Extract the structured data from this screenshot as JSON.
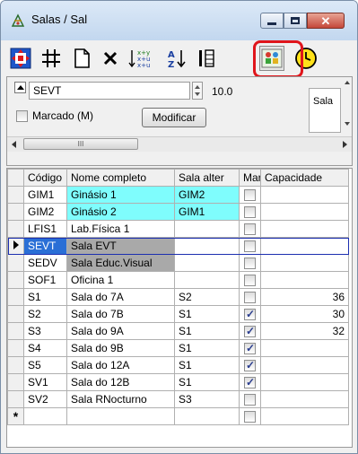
{
  "window": {
    "title": "Salas / Sal",
    "icon": "app-salas-icon"
  },
  "titlebar_buttons": [
    "minimize",
    "maximize",
    "close"
  ],
  "toolbar": {
    "tools": [
      {
        "icon": "navigate-record-icon"
      },
      {
        "icon": "grid-icon"
      },
      {
        "icon": "new-document-icon"
      },
      {
        "icon": "delete-icon"
      },
      {
        "icon": "sort-xy-icon"
      },
      {
        "icon": "sort-az-icon"
      },
      {
        "icon": "columns-icon"
      },
      {
        "icon": "room-people-icon"
      },
      {
        "icon": "clock-icon"
      }
    ],
    "highlighted": "room-people-icon",
    "highlight_color": "#e0151b"
  },
  "edit_panel": {
    "code_value": "SEVT",
    "numeric_value": "10.0",
    "marcado_label": "Marcado (M)",
    "modify_button": "Modificar",
    "sala_label": "Sala",
    "scroll_thumb": "III"
  },
  "grid": {
    "columns": [
      "Código",
      "Nome completo",
      "Sala alter",
      "Marc",
      "Capacidade"
    ],
    "rows": [
      {
        "code": "GIM1",
        "name": "Ginásio 1",
        "alt": "GIM2",
        "marc": false,
        "cap": "",
        "color": "#7ffdfd"
      },
      {
        "code": "GIM2",
        "name": "Ginásio 2",
        "alt": "GIM1",
        "marc": false,
        "cap": "",
        "color": "#7ffdfd"
      },
      {
        "code": "LFIS1",
        "name": "Lab.Física 1",
        "alt": "",
        "marc": false,
        "cap": "",
        "color": ""
      },
      {
        "code": "SEVT",
        "name": "Sala EVT",
        "alt": "",
        "marc": false,
        "cap": "",
        "color": "#a9a9a9",
        "current": true
      },
      {
        "code": "SEDV",
        "name": "Sala Educ.Visual",
        "alt": "",
        "marc": false,
        "cap": "",
        "color": "#a9a9a9"
      },
      {
        "code": "SOF1",
        "name": "Oficina 1",
        "alt": "",
        "marc": false,
        "cap": "",
        "color": ""
      },
      {
        "code": "S1",
        "name": "Sala do 7A",
        "alt": "S2",
        "marc": false,
        "cap": "36",
        "color": ""
      },
      {
        "code": "S2",
        "name": "Sala do 7B",
        "alt": "S1",
        "marc": true,
        "cap": "30",
        "color": ""
      },
      {
        "code": "S3",
        "name": "Sala do 9A",
        "alt": "S1",
        "marc": true,
        "cap": "32",
        "color": ""
      },
      {
        "code": "S4",
        "name": "Sala do 9B",
        "alt": "S1",
        "marc": true,
        "cap": "",
        "color": ""
      },
      {
        "code": "S5",
        "name": "Sala do 12A",
        "alt": "S1",
        "marc": true,
        "cap": "",
        "color": ""
      },
      {
        "code": "SV1",
        "name": "Sala do 12B",
        "alt": "S1",
        "marc": true,
        "cap": "",
        "color": ""
      },
      {
        "code": "SV2",
        "name": "Sala RNocturno",
        "alt": "S3",
        "marc": false,
        "cap": "",
        "color": ""
      }
    ],
    "new_row_marker": "*"
  }
}
